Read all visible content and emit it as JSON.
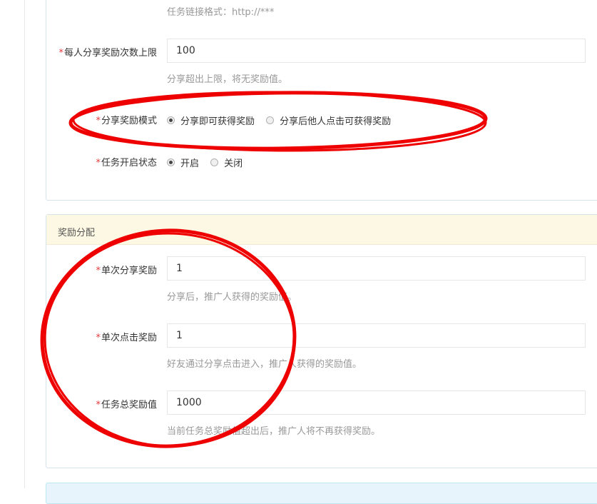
{
  "task_form": {
    "link_help": "任务链接格式：http://***",
    "share_limit": {
      "required_mark": "*",
      "label": "每人分享奖励次数上限",
      "value": "100",
      "help": "分享超出上限，将无奖励值。"
    },
    "share_mode": {
      "required_mark": "*",
      "label": "分享奖励模式",
      "options": [
        "分享即可获得奖励",
        "分享后他人点击可获得奖励"
      ],
      "selected": "分享即可获得奖励"
    },
    "task_status": {
      "required_mark": "*",
      "label": "任务开启状态",
      "options": [
        "开启",
        "关闭"
      ],
      "selected": "开启"
    }
  },
  "reward_panel": {
    "heading": "奖励分配",
    "single_share": {
      "required_mark": "*",
      "label": "单次分享奖励",
      "value": "1",
      "help": "分享后，推广人获得的奖励值。"
    },
    "single_click": {
      "required_mark": "*",
      "label": "单次点击奖励",
      "value": "1",
      "help": "好友通过分享点击进入，推广人获得的奖励值。"
    },
    "total": {
      "required_mark": "*",
      "label": "任务总奖励值",
      "value": "1000",
      "help": "当前任务总奖励值超出后，推广人将不再获得奖励。"
    }
  },
  "colors": {
    "annotation": "#ee0000",
    "required": "#e4393c",
    "heading_bg": "#fcf8e3"
  }
}
